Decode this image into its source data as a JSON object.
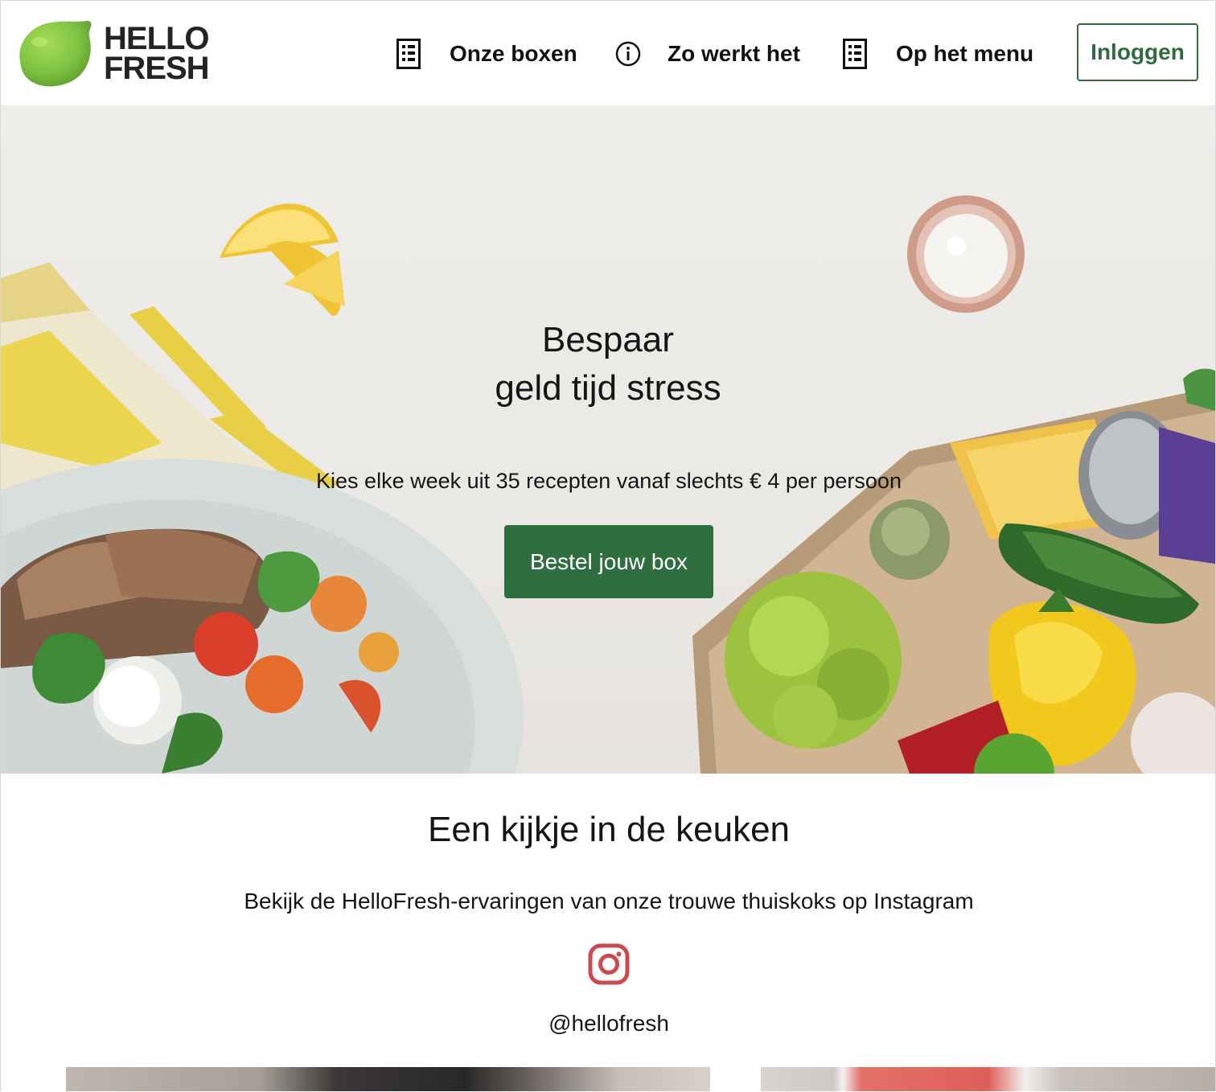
{
  "brand": {
    "name_line1": "HELLO",
    "name_line2": "FRESH",
    "lime_color": "#7ec242",
    "accent_green": "#2f6f3f"
  },
  "nav": {
    "items": [
      {
        "label": "Onze boxen",
        "icon": "menu-list-icon"
      },
      {
        "label": "Zo werkt het",
        "icon": "info-icon"
      },
      {
        "label": "Op het menu",
        "icon": "menu-list-icon"
      }
    ],
    "login_label": "Inloggen"
  },
  "hero": {
    "title_line1": "Bespaar",
    "title_line2": "geld tijd stress",
    "subtitle": "Kies elke week uit 35 recepten vanaf slechts € 4 per persoon",
    "cta_label": "Bestel jouw box"
  },
  "instagram": {
    "title": "Een kijkje in de keuken",
    "text": "Bekijk de HelloFresh-ervaringen van onze trouwe thuiskoks op Instagram",
    "icon": "instagram-icon",
    "icon_color": "#c94b50",
    "handle": "@hellofresh"
  }
}
